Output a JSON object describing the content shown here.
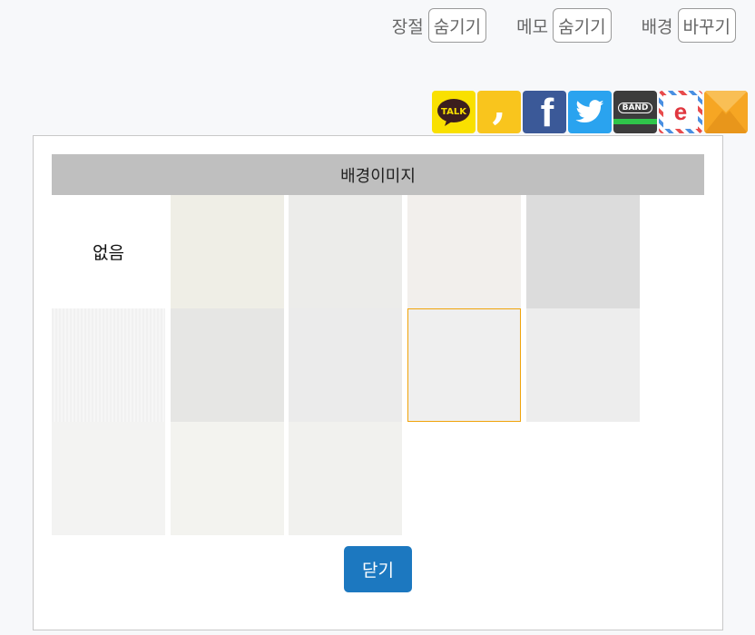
{
  "toolbar": {
    "chapter": {
      "label": "장절",
      "button": "숨기기"
    },
    "memo": {
      "label": "메모",
      "button": "숨기기"
    },
    "background": {
      "label": "배경",
      "button": "바꾸기"
    }
  },
  "share": {
    "kakaotalk": {
      "icon": "kakaotalk-icon",
      "text": "TALK",
      "color": "#f9e000"
    },
    "kakaostory": {
      "icon": "kakaostory-icon",
      "text": ",",
      "color": "#f9c51d"
    },
    "facebook": {
      "icon": "facebook-icon",
      "text": "f",
      "color": "#3b5998"
    },
    "twitter": {
      "icon": "twitter-icon",
      "color": "#1da1f2"
    },
    "band": {
      "icon": "band-icon",
      "text": "BAND",
      "color": "#3c3c3c"
    },
    "email": {
      "icon": "email-e-icon",
      "text": "e",
      "color": "#ffffff"
    },
    "mail": {
      "icon": "mail-envelope-icon",
      "color": "#f5a623"
    }
  },
  "dialog": {
    "title": "배경이미지",
    "none_label": "없음",
    "close_label": "닫기",
    "textures": [
      {
        "color": "#efeee6"
      },
      {
        "color": "#ececea"
      },
      {
        "color": "#f2efec"
      },
      {
        "color": "#dcdcdc"
      },
      {
        "color": "#f2f2f2"
      },
      {
        "color": "#e6e6e4"
      },
      {
        "color": "#ebebeb"
      },
      {
        "color": "#efefef"
      },
      {
        "color": "#ededed"
      },
      {
        "color": "#f3f3f2"
      },
      {
        "color": "#f3f3ef"
      },
      {
        "color": "#f1f1ee"
      }
    ]
  }
}
